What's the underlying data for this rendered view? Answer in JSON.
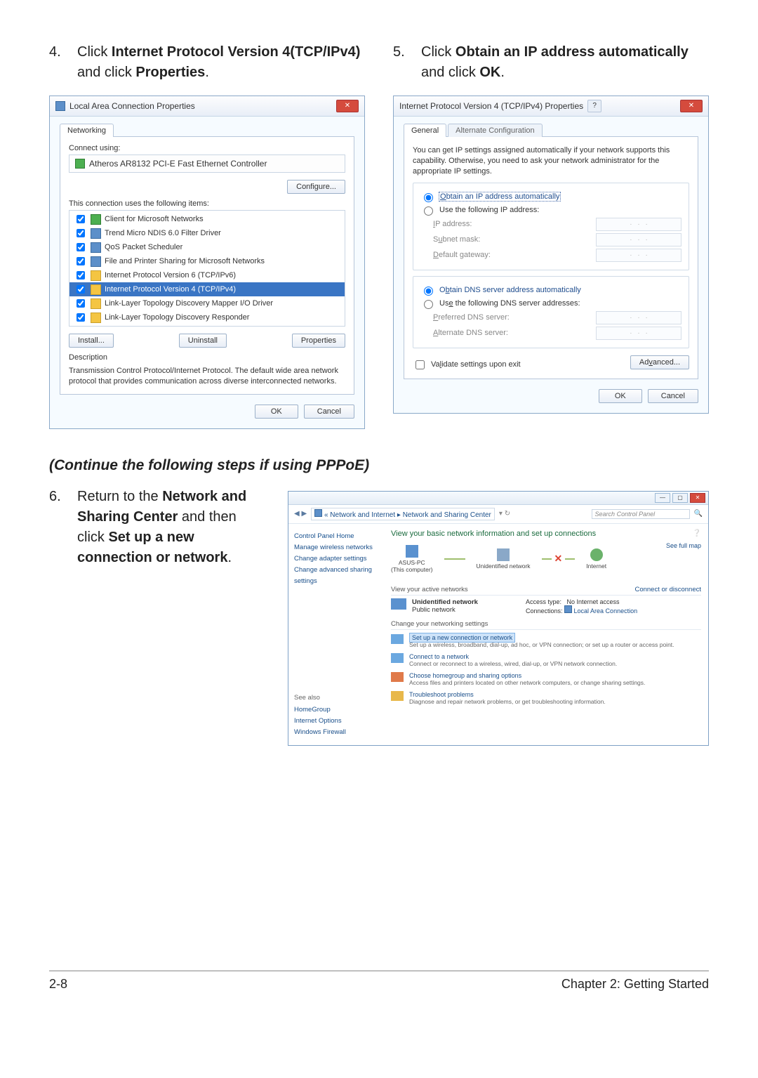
{
  "steps": {
    "s4_num": "4.",
    "s4_a": "Click ",
    "s4_b": "Internet Protocol Version 4(TCP/IPv4)",
    "s4_c": " and click ",
    "s4_d": "Properties",
    "s4_e": ".",
    "s5_num": "5.",
    "s5_a": "Click ",
    "s5_b": "Obtain an IP address automatically",
    "s5_c": " and click ",
    "s5_d": "OK",
    "s5_e": ".",
    "cont": "(Continue the following steps if using PPPoE)",
    "s6_num": "6.",
    "s6_a": "Return to the ",
    "s6_b": "Network and Sharing Center",
    "s6_c": " and then click ",
    "s6_d": "Set up a new connection or network",
    "s6_e": "."
  },
  "dlg1": {
    "title": "Local Area Connection Properties",
    "tab": "Networking",
    "connect_using": "Connect using:",
    "adapter": "Atheros AR8132 PCI-E Fast Ethernet Controller",
    "configure": "Configure...",
    "uses": "This connection uses the following items:",
    "items": {
      "i0": "Client for Microsoft Networks",
      "i1": "Trend Micro NDIS 6.0 Filter Driver",
      "i2": "QoS Packet Scheduler",
      "i3": "File and Printer Sharing for Microsoft Networks",
      "i4": "Internet Protocol Version 6 (TCP/IPv6)",
      "i5": "Internet Protocol Version 4 (TCP/IPv4)",
      "i6": "Link-Layer Topology Discovery Mapper I/O Driver",
      "i7": "Link-Layer Topology Discovery Responder"
    },
    "install": "Install...",
    "uninstall": "Uninstall",
    "properties": "Properties",
    "desc_head": "Description",
    "desc": "Transmission Control Protocol/Internet Protocol. The default wide area network protocol that provides communication across diverse interconnected networks.",
    "ok": "OK",
    "cancel": "Cancel"
  },
  "dlg2": {
    "title": "Internet Protocol Version 4 (TCP/IPv4) Properties",
    "tab1": "General",
    "tab2": "Alternate Configuration",
    "intro": "You can get IP settings assigned automatically if your network supports this capability. Otherwise, you need to ask your network administrator for the appropriate IP settings.",
    "r1": "Obtain an IP address automatically",
    "r2": "Use the following IP address:",
    "ip": "IP address:",
    "subnet": "Subnet mask:",
    "gateway": "Default gateway:",
    "r3": "Obtain DNS server address automatically",
    "r4": "Use the following DNS server addresses:",
    "pdns": "Preferred DNS server:",
    "adns": "Alternate DNS server:",
    "validate": "Validate settings upon exit",
    "advanced": "Advanced...",
    "ok": "OK",
    "cancel": "Cancel"
  },
  "win": {
    "crumb1": "« Network and Internet",
    "crumb2": "Network and Sharing Center",
    "search_ph": "Search Control Panel",
    "sb_home": "Control Panel Home",
    "sb1": "Manage wireless networks",
    "sb2": "Change adapter settings",
    "sb3": "Change advanced sharing settings",
    "sb_also": "See also",
    "sb4": "HomeGroup",
    "sb5": "Internet Options",
    "sb6": "Windows Firewall",
    "hd": "View your basic network information and set up connections",
    "fullmap": "See full map",
    "node1": "ASUS-PC",
    "node1b": "(This computer)",
    "node2": "Unidentified network",
    "node3": "Internet",
    "view_active": "View your active networks",
    "conn_disc": "Connect or disconnect",
    "unid": "Unidentified network",
    "pubnet": "Public network",
    "access_lbl": "Access type:",
    "access_val": "No Internet access",
    "conn_lbl": "Connections:",
    "conn_val": "Local Area Connection",
    "change_head": "Change your networking settings",
    "t1": "Set up a new connection or network",
    "t1d": "Set up a wireless, broadband, dial-up, ad hoc, or VPN connection; or set up a router or access point.",
    "t2": "Connect to a network",
    "t2d": "Connect or reconnect to a wireless, wired, dial-up, or VPN network connection.",
    "t3": "Choose homegroup and sharing options",
    "t3d": "Access files and printers located on other network computers, or change sharing settings.",
    "t4": "Troubleshoot problems",
    "t4d": "Diagnose and repair network problems, or get troubleshooting information."
  },
  "footer": {
    "page": "2-8",
    "chapter": "Chapter 2: Getting Started"
  }
}
